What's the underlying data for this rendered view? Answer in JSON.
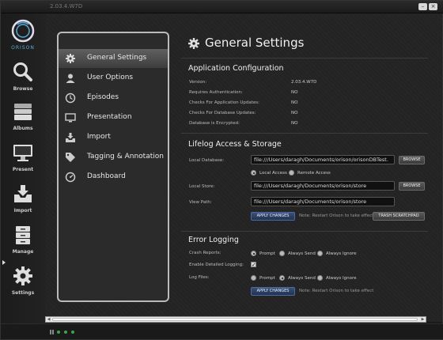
{
  "window": {
    "title": "2.03.4.W7D"
  },
  "brand": {
    "name": "ORISON",
    "accent": "#5aa9d6"
  },
  "nav": [
    {
      "label": "Browse",
      "icon": "magnifier-icon"
    },
    {
      "label": "Albums",
      "icon": "albums-icon"
    },
    {
      "label": "Present",
      "icon": "monitor-icon"
    },
    {
      "label": "Import",
      "icon": "import-tray-icon"
    },
    {
      "label": "Manage",
      "icon": "cabinet-icon"
    },
    {
      "label": "Settings",
      "icon": "gear-icon"
    }
  ],
  "menu": [
    {
      "label": "General Settings",
      "icon": "gear-icon",
      "active": true
    },
    {
      "label": "User Options",
      "icon": "user-icon"
    },
    {
      "label": "Episodes",
      "icon": "clock-icon"
    },
    {
      "label": "Presentation",
      "icon": "presentation-icon"
    },
    {
      "label": "Import",
      "icon": "import-icon"
    },
    {
      "label": "Tagging & Annotation",
      "icon": "tag-icon"
    },
    {
      "label": "Dashboard",
      "icon": "dashboard-icon"
    }
  ],
  "page": {
    "title": "General Settings"
  },
  "app_config": {
    "title": "Application Configuration",
    "rows": [
      {
        "label": "Version:",
        "value": "2.03.4.W7D"
      },
      {
        "label": "Requires Authentication:",
        "value": "NO"
      },
      {
        "label": "Checks For Application Updates:",
        "value": "NO"
      },
      {
        "label": "Checks For Database Updates:",
        "value": "NO"
      },
      {
        "label": "Database is Encrypted:",
        "value": "NO"
      }
    ]
  },
  "lifelog": {
    "title": "Lifelog Access & Storage",
    "local_db_label": "Local Database:",
    "local_db_value": "file:///Users/daragh/Documents/orison/orisonDBTest.",
    "browse_label": "BROWSE",
    "access_options": [
      "Local Access",
      "Remote Access"
    ],
    "access_selected": "Local Access",
    "local_store_label": "Local Store:",
    "local_store_value": "file:///Users/daragh/Documents/orison/store",
    "view_path_label": "View Path:",
    "view_path_value": "file:///Users/daragh/Documents/orison/store",
    "apply_label": "APPLY CHANGES",
    "note": "Note: Restart Orison to take effect",
    "trash_label": "TRASH SCRATCHPAD"
  },
  "logging": {
    "title": "Error Logging",
    "crash_label": "Crash Reports:",
    "crash_options": [
      "Prompt",
      "Always Send",
      "Always Ignore"
    ],
    "crash_selected": "Prompt",
    "detailed_label": "Enable Detailed Logging:",
    "detailed_checked": true,
    "log_files_label": "Log Files:",
    "log_options": [
      "Prompt",
      "Always Send",
      "Always Ignore"
    ],
    "log_selected": "Always Send",
    "apply_label": "APPLY CHANGES",
    "note": "Note: Restart Orison to take effect"
  }
}
